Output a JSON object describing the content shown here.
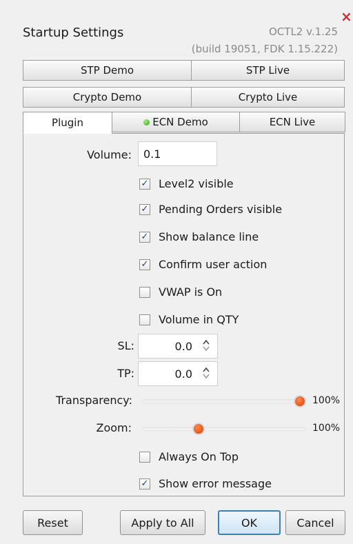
{
  "window": {
    "title": "Startup Settings",
    "version_line1": "OCTL2  v.1.25",
    "version_line2": "(build 19051, FDK 1.15.222)",
    "close_glyph": "×"
  },
  "tabs": {
    "row1": [
      {
        "label": "STP Demo"
      },
      {
        "label": "STP Live"
      }
    ],
    "row2": [
      {
        "label": "Crypto Demo"
      },
      {
        "label": "Crypto Live"
      }
    ],
    "row3": [
      {
        "label": "Plugin",
        "active": true
      },
      {
        "label": "ECN Demo",
        "status": "connected",
        "status_color": "#3cbf2a"
      },
      {
        "label": "ECN Live"
      }
    ]
  },
  "plugin": {
    "volume_label": "Volume:",
    "volume_value": "0.1",
    "checkboxes": [
      {
        "label": "Level2 visible",
        "checked": true
      },
      {
        "label": "Pending Orders visible",
        "checked": true
      },
      {
        "label": "Show balance line",
        "checked": true
      },
      {
        "label": "Confirm user action",
        "checked": true
      },
      {
        "label": "VWAP is On",
        "checked": false
      },
      {
        "label": "Volume in QTY",
        "checked": false
      }
    ],
    "sl_label": "SL:",
    "sl_value": "0.0",
    "tp_label": "TP:",
    "tp_value": "0.0",
    "transparency_label": "Transparency:",
    "transparency_value": "100%",
    "transparency_level": 1.0,
    "zoom_label": "Zoom:",
    "zoom_value": "100%",
    "zoom_level": 0.33,
    "bottom_checkboxes": [
      {
        "label": "Always On Top",
        "checked": false
      },
      {
        "label": "Show error message",
        "checked": true
      }
    ],
    "check_glyph": "✓"
  },
  "buttons": {
    "reset": "Reset",
    "apply_all": "Apply to All",
    "ok": "OK",
    "cancel": "Cancel"
  },
  "colors": {
    "accent": "#3c7fb1",
    "slider_thumb": "#e8520f",
    "close": "#d03030"
  }
}
